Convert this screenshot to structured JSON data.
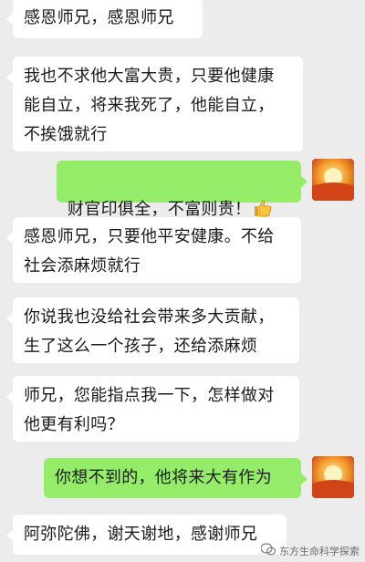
{
  "messages": [
    {
      "side": "in",
      "text": "感恩师兄，感恩师兄"
    },
    {
      "side": "in",
      "text": "我也不求他大富大贵，只要他健康\n能自立，将来我死了，他能自立，\n不挨饿就行"
    },
    {
      "side": "out",
      "text": "财官印俱全，不富则贵！",
      "emoji": "thumbs-up-icon"
    },
    {
      "side": "in",
      "text": "感恩师兄，只要他平安健康。不给\n社会添麻烦就行"
    },
    {
      "side": "in",
      "text": "你说我也没给社会带来多大贡献，\n生了这么一个孩子，还给添麻烦"
    },
    {
      "side": "in",
      "text": "师兄，您能指点我一下，怎样做对\n他更有利吗？"
    },
    {
      "side": "out",
      "text": "你想不到的，他将来大有作为"
    },
    {
      "side": "in",
      "text": "阿弥陀佛，谢天谢地，感谢师兄"
    }
  ],
  "watermark": {
    "icon": "wechat-icon",
    "text": "东方生命科学探索"
  },
  "colors": {
    "background": "#ececec",
    "incoming_bubble": "#ffffff",
    "outgoing_bubble": "#95ec69"
  }
}
